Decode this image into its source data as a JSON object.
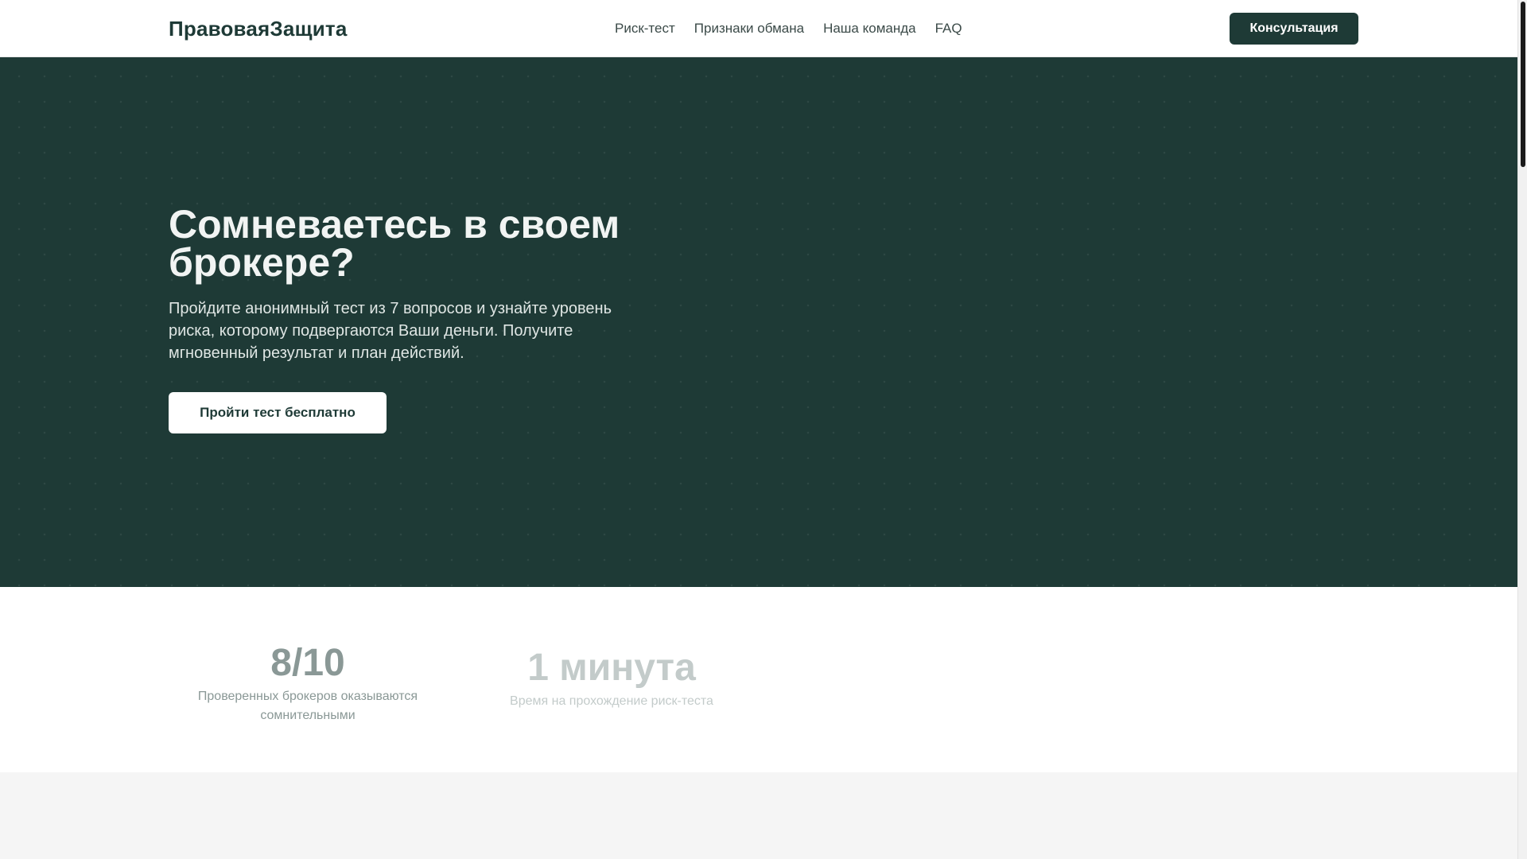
{
  "header": {
    "brand": "ПравоваяЗащита",
    "nav": [
      "Риск-тест",
      "Признаки обмана",
      "Наша команда",
      "FAQ"
    ],
    "cta_label": "Консультация"
  },
  "hero": {
    "title": "Сомневаетесь в своем брокере?",
    "subtitle": "Пройдите анонимный тест из 7 вопросов и узнайте уровень риска, которому подвергаются Ваши деньги. Получите мгновенный результат и план действий.",
    "cta_label": "Пройти тест бесплатно"
  },
  "stats": [
    {
      "value": "8/10",
      "label": "Проверенных брокеров оказываются сомнительными"
    },
    {
      "value": "1 минута",
      "label": "Время на прохождение риск-теста"
    }
  ],
  "colors": {
    "primary": "#1e3a36",
    "hero_text": "#f1f4f3",
    "band": "#f5f5f5"
  }
}
